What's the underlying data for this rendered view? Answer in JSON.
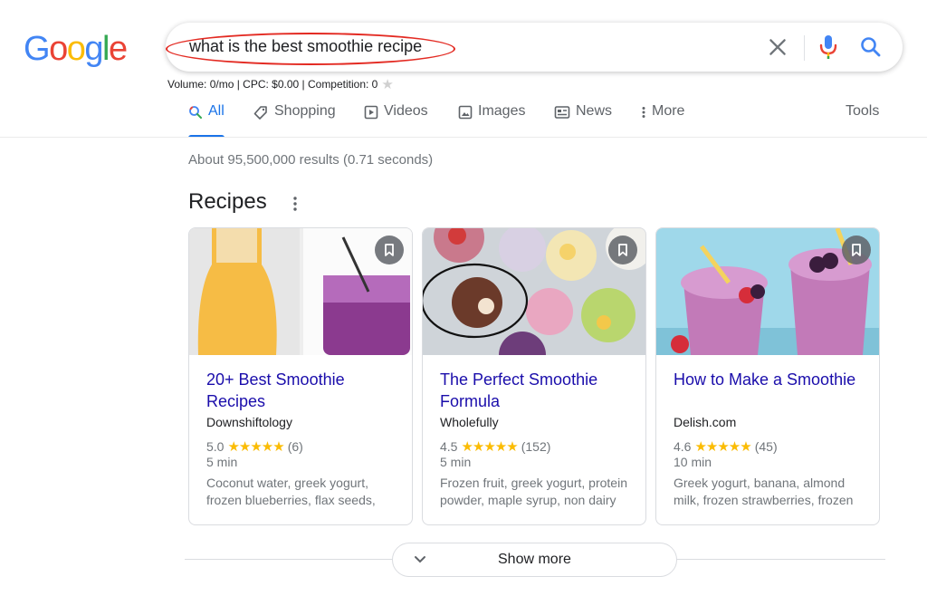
{
  "logo": {
    "letters": [
      "G",
      "o",
      "o",
      "g",
      "l",
      "e"
    ],
    "colors": [
      "#4285f4",
      "#ea4335",
      "#fbbc05",
      "#4285f4",
      "#34a853",
      "#ea4335"
    ]
  },
  "search": {
    "query": "what is the best smoothie recipe"
  },
  "keyword_info": {
    "text": "Volume: 0/mo | CPC: $0.00 | Competition: 0",
    "star": "★"
  },
  "tabs": [
    {
      "label": "All",
      "icon": "search-icon"
    },
    {
      "label": "Shopping",
      "icon": "tag-icon"
    },
    {
      "label": "Videos",
      "icon": "play-icon"
    },
    {
      "label": "Images",
      "icon": "image-icon"
    },
    {
      "label": "News",
      "icon": "news-icon"
    },
    {
      "label": "More",
      "icon": "more-vertical-icon"
    }
  ],
  "tools_label": "Tools",
  "result_stats": "About 95,500,000 results (0.71 seconds)",
  "recipes": {
    "title": "Recipes",
    "cards": [
      {
        "title": "20+ Best Smoothie Recipes",
        "source": "Downshiftology",
        "rating": "5.0",
        "stars": "★★★★★",
        "reviews": "(6)",
        "time": "5 min",
        "desc": "Coconut water, greek yogurt, frozen blueberries, flax seeds,",
        "rating_value": 5.0
      },
      {
        "title": "The Perfect Smoothie Formula",
        "source": "Wholefully",
        "rating": "4.5",
        "stars": "★★★★★",
        "reviews": "(152)",
        "time": "5 min",
        "desc": "Frozen fruit, greek yogurt, protein powder, maple syrup, non dairy",
        "rating_value": 4.5
      },
      {
        "title": "How to Make a Smoothie",
        "source": "Delish.com",
        "rating": "4.6",
        "stars": "★★★★★",
        "reviews": "(45)",
        "time": "10 min",
        "desc": "Greek yogurt, banana, almond milk, frozen strawberries, frozen",
        "rating_value": 4.6
      }
    ]
  },
  "show_more": {
    "label": "Show more"
  },
  "colors": {
    "link": "#1a0dab",
    "accent": "#1a73e8",
    "star": "#fbbc04",
    "annotation_red": "#e32a22"
  }
}
